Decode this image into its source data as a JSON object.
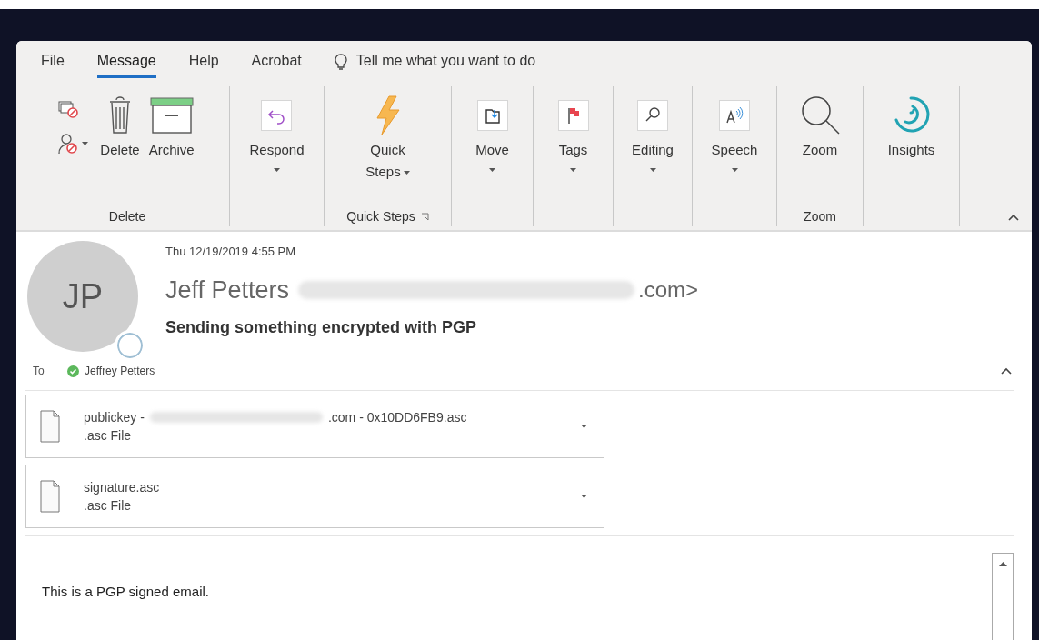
{
  "tabs": [
    {
      "label": "File",
      "selected": false
    },
    {
      "label": "Message",
      "selected": true
    },
    {
      "label": "Help",
      "selected": false
    },
    {
      "label": "Acrobat",
      "selected": false
    }
  ],
  "tell_me": "Tell me what you want to do",
  "ribbon_groups": [
    {
      "label": "Delete",
      "commands": [
        {
          "label": "Delete",
          "dropdown": false
        },
        {
          "label": "Archive",
          "dropdown": false
        }
      ]
    },
    {
      "commands": [
        {
          "label": "Respond",
          "dropdown": true
        }
      ]
    },
    {
      "label": "Quick Steps",
      "commands": [
        {
          "label": "Quick Steps",
          "dropdown": true
        }
      ]
    },
    {
      "commands": [
        {
          "label": "Move",
          "dropdown": true
        }
      ]
    },
    {
      "commands": [
        {
          "label": "Tags",
          "dropdown": true
        }
      ]
    },
    {
      "commands": [
        {
          "label": "Editing",
          "dropdown": true
        }
      ]
    },
    {
      "commands": [
        {
          "label": "Speech",
          "dropdown": true
        }
      ]
    },
    {
      "label": "Zoom",
      "commands": [
        {
          "label": "Zoom",
          "dropdown": false
        }
      ]
    },
    {
      "commands": [
        {
          "label": "Insights",
          "dropdown": false
        }
      ]
    }
  ],
  "message": {
    "date": "Thu 12/19/2019 4:55 PM",
    "avatar_initials": "JP",
    "sender_name": "Jeff Petters",
    "sender_address_end": ".com>",
    "subject": "Sending something encrypted with PGP",
    "to_label": "To",
    "recipient": "Jeffrey Petters",
    "attachments": [
      {
        "name_start": "publickey -",
        "name_end": ".com - 0x10DD6FB9.asc",
        "type": ".asc File"
      },
      {
        "name_start": "signature.asc",
        "type": ".asc File"
      }
    ],
    "body": "This is a PGP signed email."
  }
}
